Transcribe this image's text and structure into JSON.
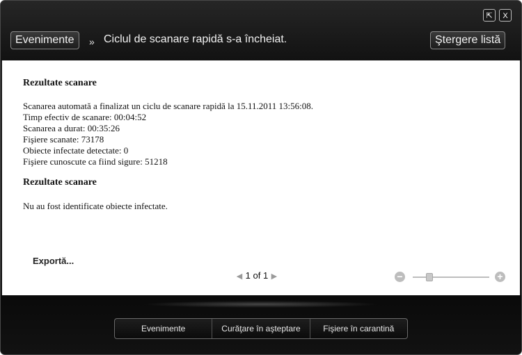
{
  "window": {
    "restore_glyph": "⇱",
    "close_glyph": "X"
  },
  "header": {
    "events_button": "Evenimente",
    "separator": "»",
    "title": "Ciclul de scanare rapidă s-a încheiat.",
    "clear_list_button": "Ştergere listă"
  },
  "report": {
    "heading1": "Rezultate scanare",
    "lines": [
      "Scanarea automată a finalizat un ciclu de scanare rapidă la 15.11.2011 13:56:08.",
      "Timp efectiv de scanare: 00:04:52",
      "Scanarea a durat: 00:35:26",
      "Fişiere scanate: 73178",
      "Obiecte infectate detectate: 0",
      "Fişiere cunoscute ca fiind sigure: 51218"
    ],
    "heading2": "Rezultate scanare",
    "result": "Nu au fost identificate obiecte infectate."
  },
  "footer_controls": {
    "export_link": "Exportă...",
    "page_current": "1",
    "page_of": "of",
    "page_total": "1",
    "zoom_level": 0.22
  },
  "bottom_tabs": [
    "Evenimente",
    "Curăţare în aşteptare",
    "Fişiere în carantină"
  ],
  "colors": {
    "chrome": "#141414",
    "content_bg": "#ffffff",
    "text": "#111111"
  }
}
